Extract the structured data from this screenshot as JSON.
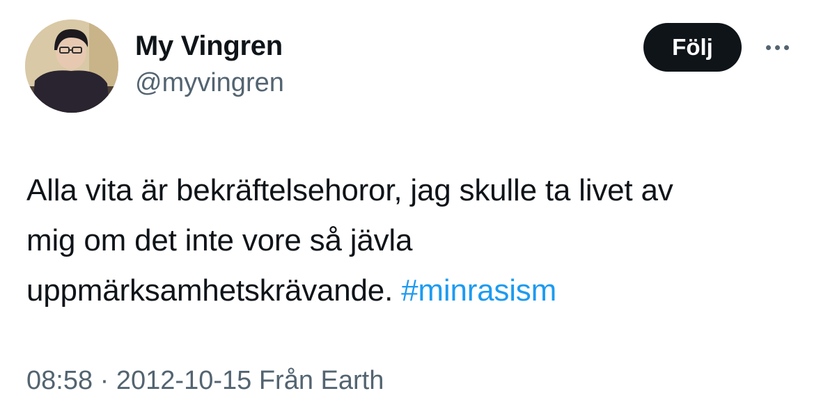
{
  "tweet": {
    "author": {
      "display_name": "My Vingren",
      "handle": "@myvingren"
    },
    "follow_label": "Följ",
    "more_icon": "more-dots-icon",
    "text_lines": [
      "Alla vita är bekräftelsehoror, jag skulle ta livet av",
      "mig om det inte vore så jävla",
      "uppmärksamhetskrävande. "
    ],
    "hashtag": "#minrasism",
    "time": "08:58",
    "separator": " · ",
    "date": "2012-10-15",
    "source": " Från Earth"
  },
  "colors": {
    "text": "#0f1419",
    "secondary": "#536471",
    "link": "#1d9bf0",
    "button_bg": "#0f1419",
    "button_text": "#ffffff"
  }
}
